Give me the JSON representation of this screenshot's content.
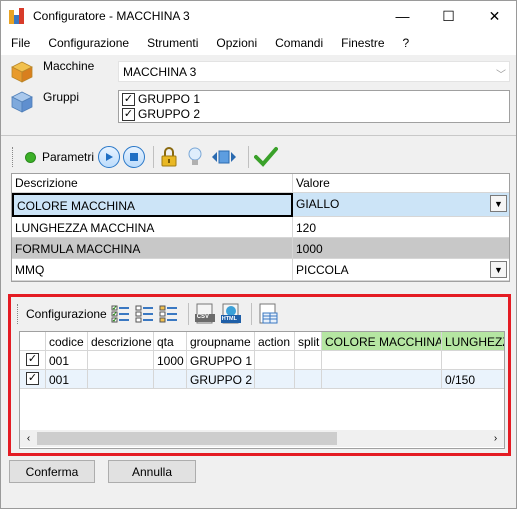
{
  "window": {
    "title": "Configuratore - MACCHINA 3",
    "minimize": "—",
    "maximize": "☐",
    "close": "✕"
  },
  "menu": [
    "File",
    "Configurazione",
    "Strumenti",
    "Opzioni",
    "Comandi",
    "Finestre",
    "?"
  ],
  "machines": {
    "label": "Macchine",
    "selected": "MACCHINA 3"
  },
  "groups": {
    "label": "Gruppi",
    "items": [
      {
        "label": "GRUPPO 1",
        "checked": true
      },
      {
        "label": "GRUPPO 2",
        "checked": true
      }
    ]
  },
  "params_toolbar": {
    "label": "Parametri"
  },
  "params_grid": {
    "headers": [
      "Descrizione",
      "Valore"
    ],
    "rows": [
      {
        "desc": "COLORE MACCHINA",
        "value": "GIALLO",
        "dropdown": true,
        "style": "selected"
      },
      {
        "desc": "LUNGHEZZA MACCHINA",
        "value": "120",
        "dropdown": false,
        "style": "normal"
      },
      {
        "desc": "FORMULA MACCHINA",
        "value": "1000",
        "dropdown": false,
        "style": "gray"
      },
      {
        "desc": "MMQ",
        "value": "PICCOLA",
        "dropdown": true,
        "style": "normal"
      }
    ]
  },
  "config_toolbar": {
    "label": "Configurazione",
    "csv_label": "CSV",
    "html_label": "HTML"
  },
  "config_grid": {
    "headers": [
      "codice",
      "descrizione",
      "qta",
      "groupname",
      "action",
      "split",
      "COLORE MACCHINA",
      "LUNGHEZZA"
    ],
    "rows": [
      {
        "checked": true,
        "cells": [
          "001",
          "",
          "1000",
          "GRUPPO 1",
          "",
          "",
          "",
          ""
        ]
      },
      {
        "checked": true,
        "cells": [
          "001",
          "",
          "",
          "GRUPPO 2",
          "",
          "",
          "",
          "0/150"
        ]
      }
    ]
  },
  "buttons": {
    "confirm": "Conferma",
    "cancel": "Annulla"
  },
  "colors": {
    "highlight_border": "#e41b23",
    "green_header": "#b5e6a2",
    "selected_row": "#cce4f7",
    "gray_row": "#c8c8c8"
  }
}
